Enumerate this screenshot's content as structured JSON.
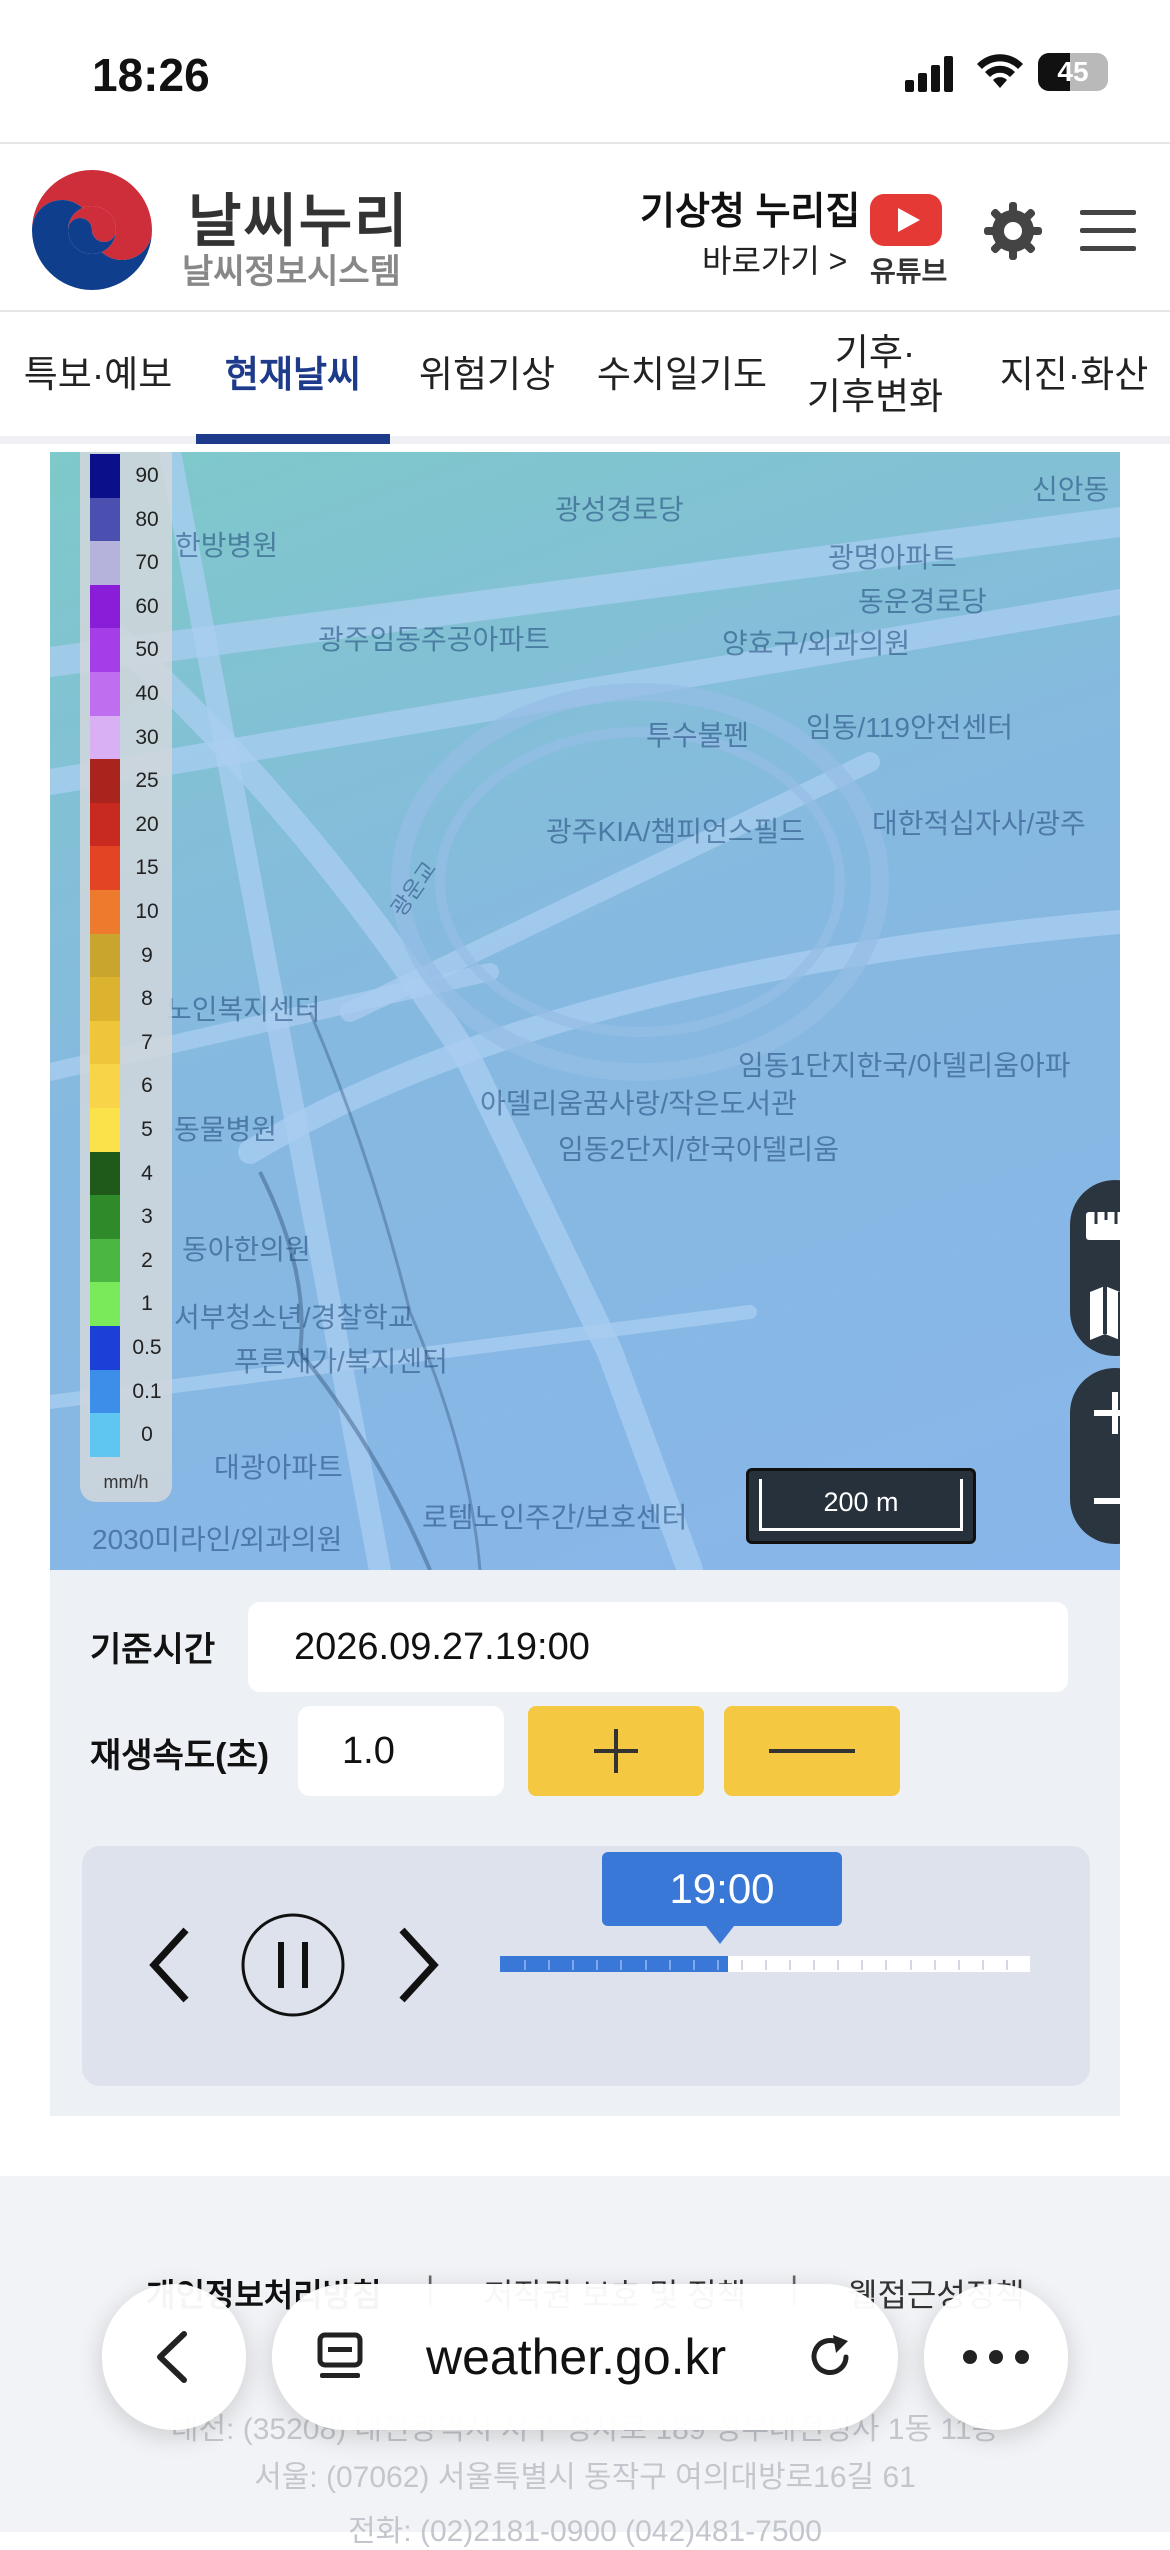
{
  "status_bar": {
    "time": "18:26",
    "battery": "45"
  },
  "header": {
    "logo_title": "날씨누리",
    "logo_subtitle": "날씨정보시스템",
    "nurijip_title": "기상청 누리집",
    "nurijip_link": "바로가기 >",
    "youtube_label": "유튜브",
    "icons": [
      "gear-icon",
      "menu-icon",
      "youtube-icon"
    ]
  },
  "nav": {
    "tabs": [
      {
        "label": "특보·예보",
        "active": false
      },
      {
        "label": "현재날씨",
        "active": true
      },
      {
        "label": "위험기상",
        "active": false
      },
      {
        "label": "수치일기도",
        "active": false
      },
      {
        "label": "기후·\n기후변화",
        "active": false
      },
      {
        "label": "지진·화산",
        "active": false
      }
    ]
  },
  "map": {
    "labels": [
      "광성경로당",
      "신안동",
      "한방병원",
      "광명아파트",
      "동운경로당",
      "광주임동주공아파트",
      "양효구/외과의원",
      "투수불펜",
      "임동/119안전센터",
      "광주KIA/챔피언스필드",
      "대한적십자사/광주",
      "광운교",
      "노인복지센터",
      "임동1단지한국/아델리움아파",
      "아델리움꿈사랑/작은도서관",
      "임동2단지/한국아델리움",
      "동물병원",
      "동아한의원",
      "서부청소년/경찰학교",
      "푸른재가/복지센터",
      "대광아파트",
      "로템노인주간/보호센터",
      "2030미라인/외과의원"
    ],
    "legend": {
      "unit": "mm/h",
      "levels": [
        {
          "value": "90",
          "color": "#0b0f8a"
        },
        {
          "value": "80",
          "color": "#4a4fb0"
        },
        {
          "value": "70",
          "color": "#b5b3dc"
        },
        {
          "value": "60",
          "color": "#8a1ed8"
        },
        {
          "value": "50",
          "color": "#a63ee8"
        },
        {
          "value": "40",
          "color": "#bf6ef0"
        },
        {
          "value": "30",
          "color": "#dab0f5"
        },
        {
          "value": "25",
          "color": "#a8241c"
        },
        {
          "value": "20",
          "color": "#c82a1f"
        },
        {
          "value": "15",
          "color": "#e24424"
        },
        {
          "value": "10",
          "color": "#ee7a2e"
        },
        {
          "value": "9",
          "color": "#c9a52e"
        },
        {
          "value": "8",
          "color": "#dcb32e"
        },
        {
          "value": "7",
          "color": "#efc63a"
        },
        {
          "value": "6",
          "color": "#f7d448"
        },
        {
          "value": "5",
          "color": "#fbe24a"
        },
        {
          "value": "4",
          "color": "#1f5a1a"
        },
        {
          "value": "3",
          "color": "#2f8a2a"
        },
        {
          "value": "2",
          "color": "#4bb642"
        },
        {
          "value": "1",
          "color": "#7aea5a"
        },
        {
          "value": "0.5",
          "color": "#1c3fd8"
        },
        {
          "value": "0.1",
          "color": "#3d8ee8"
        },
        {
          "value": "0",
          "color": "#5fc6f2"
        }
      ]
    },
    "scale_label": "200 m",
    "controls": [
      "ruler-icon",
      "map-layers-icon",
      "zoom-in-icon",
      "zoom-out-icon"
    ]
  },
  "panel": {
    "base_time_label": "기준시간",
    "base_time_value": "2026.09.27.19:00",
    "speed_label": "재생속도(초)",
    "speed_value": "1.0",
    "plus_label": "+",
    "minus_label": "—",
    "player": {
      "current_time": "19:00",
      "progress": 0.43,
      "ticks": 22
    }
  },
  "footer": {
    "links": [
      "개인정보처리방침",
      "저작권 보호 및 정책",
      "웹접근성정책"
    ],
    "separator": "|",
    "address1": "대전: (35208) 대전광역시 서구 청사로 189 정부대전청사 1동 11층",
    "address2": "서울: (07062) 서울특별시 동작구 여의대방로16길 61",
    "phone": "전화: (02)2181-0900 (042)481-7500"
  },
  "browser": {
    "url": "weather.go.kr"
  }
}
